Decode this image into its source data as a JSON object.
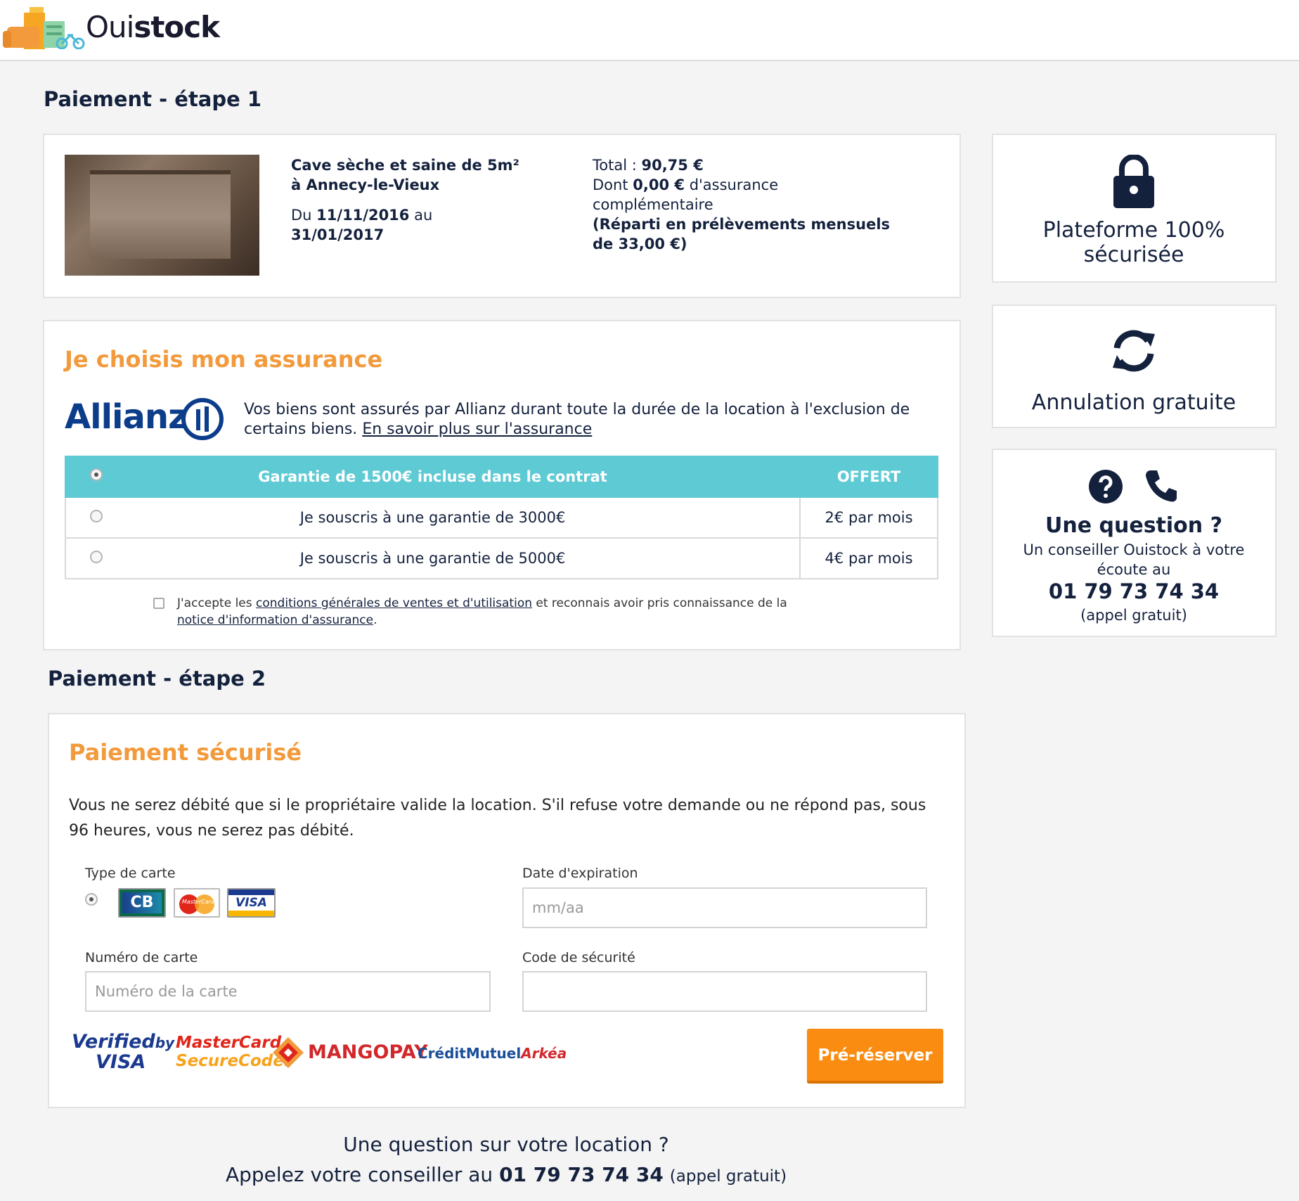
{
  "brand": {
    "logo_text_light": "Oui",
    "logo_text_bold": "stock"
  },
  "step1": {
    "title": "Paiement - étape 1",
    "listing_title": "Cave sèche et saine de 5m² à Annecy-le-Vieux",
    "dates_prefix": "Du",
    "date_from": "11/11/2016",
    "dates_mid": "au",
    "date_to": "31/01/2017",
    "total_label": "Total :",
    "total_value": "90,75 €",
    "insurance_prefix": "Dont",
    "insurance_value": "0,00 €",
    "insurance_suffix": "d'assurance complémentaire",
    "installments": "(Réparti en prélèvements mensuels de 33,00 €)"
  },
  "insurance": {
    "title": "Je choisis mon assurance",
    "partner_name": "Allianz",
    "description": "Vos biens sont assurés par Allianz durant toute la durée de la location à l'exclusion de certains biens.",
    "learn_more": "En savoir plus sur l'assurance",
    "options": [
      {
        "label": "Garantie de 1500€ incluse dans le contrat",
        "price": "OFFERT",
        "selected": true
      },
      {
        "label": "Je souscris à une garantie de 3000€",
        "price": "2€ par mois",
        "selected": false
      },
      {
        "label": "Je souscris à une garantie de 5000€",
        "price": "4€ par mois",
        "selected": false
      }
    ],
    "terms_prefix": "J'accepte les",
    "terms_link": "conditions générales de ventes et d'utilisation",
    "terms_mid": "et reconnais avoir pris connaissance de la",
    "notice_link": "notice d'information d'assurance",
    "terms_end": "."
  },
  "side": {
    "secure_title": "Plateforme 100% sécurisée",
    "cancel_title": "Annulation gratuite",
    "question_title": "Une question ?",
    "question_text": "Un conseiller Ouistock à votre écoute au",
    "phone": "01 79 73 74 34",
    "phone_note": "(appel gratuit)"
  },
  "step2": {
    "title": "Paiement - étape 2",
    "card_title": "Paiement sécurisé",
    "notice": "Vous ne serez débité que si le propriétaire valide la location. S'il refuse votre demande ou ne répond pas, sous 96 heures, vous ne serez pas débité.",
    "card_type_label": "Type de carte",
    "expiry_label": "Date d'expiration",
    "expiry_placeholder": "mm/aa",
    "number_label": "Numéro de carte",
    "number_placeholder": "Numéro de la carte",
    "cvv_label": "Code de sécurité",
    "cvv_value": "",
    "card_logos": [
      "CB",
      "MasterCard",
      "VISA"
    ],
    "trust_logos": {
      "verified_1": "Verified",
      "verified_by": "by",
      "verified_2": "VISA",
      "mc_1": "MasterCard.",
      "mc_2": "SecureCode.",
      "mangopay": "MANGOPAY",
      "cm_1": "CréditMutuel",
      "cm_2": "Arkéa"
    },
    "submit_label": "Pré-réserver"
  },
  "footer": {
    "question": "Une question sur votre location ?",
    "call_prefix": "Appelez votre conseiller au",
    "phone": "01 79 73 74 34",
    "note": "(appel gratuit)"
  },
  "colors": {
    "accent_orange": "#f29a3c",
    "button_orange": "#fa8c12",
    "teal": "#5ecad4",
    "navy": "#14213d"
  }
}
